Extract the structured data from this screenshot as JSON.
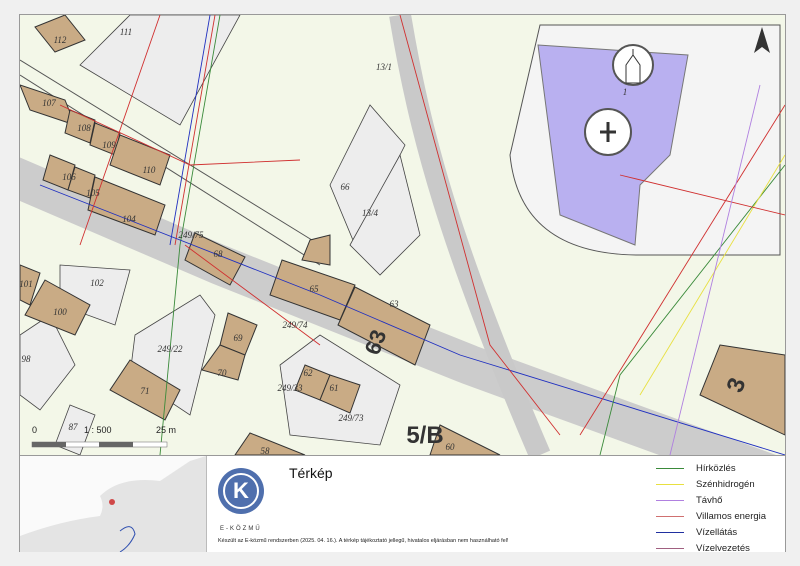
{
  "map": {
    "parcels": [
      "112",
      "111",
      "107",
      "108",
      "109",
      "110",
      "106",
      "105",
      "104",
      "102",
      "101",
      "100",
      "98",
      "68",
      "65",
      "63",
      "66",
      "13/4",
      "13/1",
      "249/74",
      "69",
      "70",
      "249/22",
      "71",
      "62",
      "61",
      "249/33",
      "249/73",
      "87",
      "58",
      "60",
      "249/75",
      "1"
    ],
    "house_numbers": [
      "63",
      "5/B",
      "3"
    ],
    "north_arrow": "north-arrow-icon",
    "church_symbol": "church-icon",
    "cemetery_symbol": "cemetery-icon"
  },
  "scale": {
    "start": "0",
    "ratio": "1 : 500",
    "end": "25 m"
  },
  "footer": {
    "title": "Térkép",
    "brand": "E-KÖZMŰ",
    "logo_letter": "K",
    "note": "Készült az E-közmű rendszerben (2025. 04. 16.). A térkép tájékoztató jellegű, hivatalos eljárásban nem használható fel!",
    "legend": [
      {
        "label": "Hírközlés",
        "color": "#3a8a3a"
      },
      {
        "label": "Szénhidrogén",
        "color": "#e8e040"
      },
      {
        "label": "Távhő",
        "color": "#b080e0"
      },
      {
        "label": "Villamos energia",
        "color": "#d03030"
      },
      {
        "label": "Vízellátás",
        "color": "#2030c0"
      },
      {
        "label": "Vízelvezetés",
        "color": "#a04040"
      }
    ]
  },
  "colors": {
    "building": "#c9ab85",
    "church": "#b9b0f0",
    "road": "#c9c9c9"
  }
}
